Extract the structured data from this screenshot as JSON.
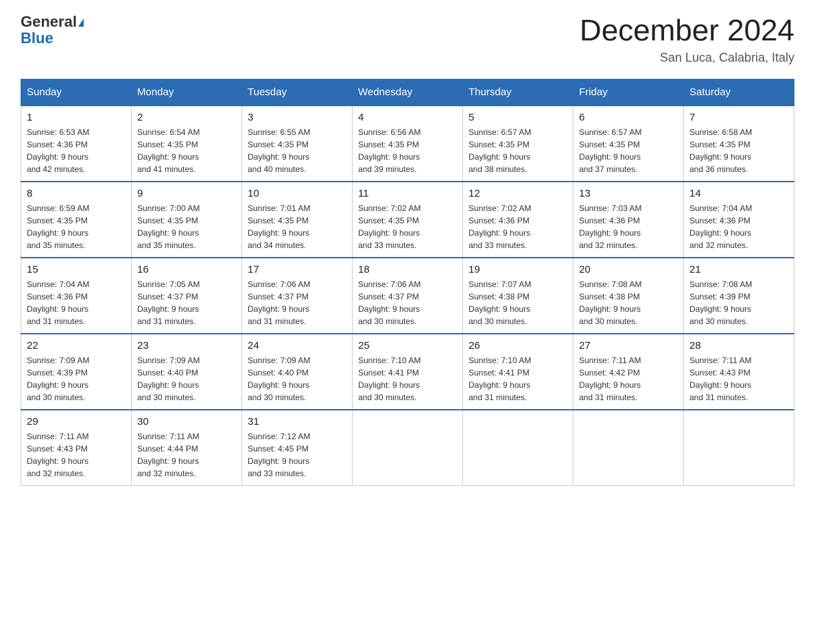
{
  "header": {
    "logo_line1": "General",
    "logo_line2": "Blue",
    "calendar_title": "December 2024",
    "calendar_subtitle": "San Luca, Calabria, Italy"
  },
  "weekdays": [
    "Sunday",
    "Monday",
    "Tuesday",
    "Wednesday",
    "Thursday",
    "Friday",
    "Saturday"
  ],
  "weeks": [
    [
      {
        "day": "1",
        "sunrise": "6:53 AM",
        "sunset": "4:36 PM",
        "daylight": "9 hours and 42 minutes."
      },
      {
        "day": "2",
        "sunrise": "6:54 AM",
        "sunset": "4:35 PM",
        "daylight": "9 hours and 41 minutes."
      },
      {
        "day": "3",
        "sunrise": "6:55 AM",
        "sunset": "4:35 PM",
        "daylight": "9 hours and 40 minutes."
      },
      {
        "day": "4",
        "sunrise": "6:56 AM",
        "sunset": "4:35 PM",
        "daylight": "9 hours and 39 minutes."
      },
      {
        "day": "5",
        "sunrise": "6:57 AM",
        "sunset": "4:35 PM",
        "daylight": "9 hours and 38 minutes."
      },
      {
        "day": "6",
        "sunrise": "6:57 AM",
        "sunset": "4:35 PM",
        "daylight": "9 hours and 37 minutes."
      },
      {
        "day": "7",
        "sunrise": "6:58 AM",
        "sunset": "4:35 PM",
        "daylight": "9 hours and 36 minutes."
      }
    ],
    [
      {
        "day": "8",
        "sunrise": "6:59 AM",
        "sunset": "4:35 PM",
        "daylight": "9 hours and 35 minutes."
      },
      {
        "day": "9",
        "sunrise": "7:00 AM",
        "sunset": "4:35 PM",
        "daylight": "9 hours and 35 minutes."
      },
      {
        "day": "10",
        "sunrise": "7:01 AM",
        "sunset": "4:35 PM",
        "daylight": "9 hours and 34 minutes."
      },
      {
        "day": "11",
        "sunrise": "7:02 AM",
        "sunset": "4:35 PM",
        "daylight": "9 hours and 33 minutes."
      },
      {
        "day": "12",
        "sunrise": "7:02 AM",
        "sunset": "4:36 PM",
        "daylight": "9 hours and 33 minutes."
      },
      {
        "day": "13",
        "sunrise": "7:03 AM",
        "sunset": "4:36 PM",
        "daylight": "9 hours and 32 minutes."
      },
      {
        "day": "14",
        "sunrise": "7:04 AM",
        "sunset": "4:36 PM",
        "daylight": "9 hours and 32 minutes."
      }
    ],
    [
      {
        "day": "15",
        "sunrise": "7:04 AM",
        "sunset": "4:36 PM",
        "daylight": "9 hours and 31 minutes."
      },
      {
        "day": "16",
        "sunrise": "7:05 AM",
        "sunset": "4:37 PM",
        "daylight": "9 hours and 31 minutes."
      },
      {
        "day": "17",
        "sunrise": "7:06 AM",
        "sunset": "4:37 PM",
        "daylight": "9 hours and 31 minutes."
      },
      {
        "day": "18",
        "sunrise": "7:06 AM",
        "sunset": "4:37 PM",
        "daylight": "9 hours and 30 minutes."
      },
      {
        "day": "19",
        "sunrise": "7:07 AM",
        "sunset": "4:38 PM",
        "daylight": "9 hours and 30 minutes."
      },
      {
        "day": "20",
        "sunrise": "7:08 AM",
        "sunset": "4:38 PM",
        "daylight": "9 hours and 30 minutes."
      },
      {
        "day": "21",
        "sunrise": "7:08 AM",
        "sunset": "4:39 PM",
        "daylight": "9 hours and 30 minutes."
      }
    ],
    [
      {
        "day": "22",
        "sunrise": "7:09 AM",
        "sunset": "4:39 PM",
        "daylight": "9 hours and 30 minutes."
      },
      {
        "day": "23",
        "sunrise": "7:09 AM",
        "sunset": "4:40 PM",
        "daylight": "9 hours and 30 minutes."
      },
      {
        "day": "24",
        "sunrise": "7:09 AM",
        "sunset": "4:40 PM",
        "daylight": "9 hours and 30 minutes."
      },
      {
        "day": "25",
        "sunrise": "7:10 AM",
        "sunset": "4:41 PM",
        "daylight": "9 hours and 30 minutes."
      },
      {
        "day": "26",
        "sunrise": "7:10 AM",
        "sunset": "4:41 PM",
        "daylight": "9 hours and 31 minutes."
      },
      {
        "day": "27",
        "sunrise": "7:11 AM",
        "sunset": "4:42 PM",
        "daylight": "9 hours and 31 minutes."
      },
      {
        "day": "28",
        "sunrise": "7:11 AM",
        "sunset": "4:43 PM",
        "daylight": "9 hours and 31 minutes."
      }
    ],
    [
      {
        "day": "29",
        "sunrise": "7:11 AM",
        "sunset": "4:43 PM",
        "daylight": "9 hours and 32 minutes."
      },
      {
        "day": "30",
        "sunrise": "7:11 AM",
        "sunset": "4:44 PM",
        "daylight": "9 hours and 32 minutes."
      },
      {
        "day": "31",
        "sunrise": "7:12 AM",
        "sunset": "4:45 PM",
        "daylight": "9 hours and 33 minutes."
      },
      null,
      null,
      null,
      null
    ]
  ],
  "labels": {
    "sunrise": "Sunrise:",
    "sunset": "Sunset:",
    "daylight": "Daylight:"
  }
}
